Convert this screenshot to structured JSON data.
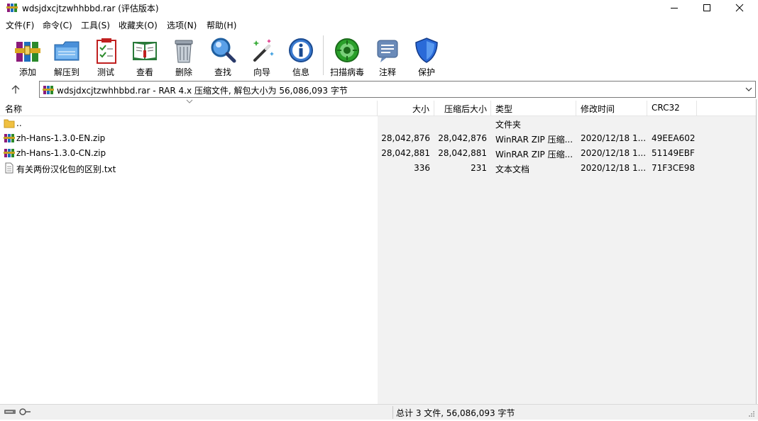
{
  "window": {
    "title": "wdsjdxcjtzwhhbbd.rar (评估版本)"
  },
  "menu": {
    "items": [
      "文件(F)",
      "命令(C)",
      "工具(S)",
      "收藏夹(O)",
      "选项(N)",
      "帮助(H)"
    ]
  },
  "toolbar": {
    "buttons": [
      {
        "label": "添加",
        "icon": "add-archive-icon"
      },
      {
        "label": "解压到",
        "icon": "extract-icon"
      },
      {
        "label": "测试",
        "icon": "test-icon"
      },
      {
        "label": "查看",
        "icon": "view-book-icon"
      },
      {
        "label": "删除",
        "icon": "trash-icon"
      },
      {
        "label": "查找",
        "icon": "magnifier-icon"
      },
      {
        "label": "向导",
        "icon": "wizard-wand-icon"
      },
      {
        "label": "信息",
        "icon": "info-icon"
      },
      {
        "label": "扫描病毒",
        "icon": "virus-scan-icon"
      },
      {
        "label": "注释",
        "icon": "comment-icon"
      },
      {
        "label": "保护",
        "icon": "shield-icon"
      }
    ]
  },
  "address": {
    "text": "wdsjdxcjtzwhhbbd.rar - RAR 4.x 压缩文件, 解包大小为 56,086,093 字节"
  },
  "columns": {
    "name": "名称",
    "size": "大小",
    "packed": "压缩后大小",
    "type": "类型",
    "modified": "修改时间",
    "crc": "CRC32"
  },
  "files": [
    {
      "name": "..",
      "size": "",
      "packed": "",
      "type": "文件夹",
      "modified": "",
      "crc": "",
      "icon": "folder-icon"
    },
    {
      "name": "zh-Hans-1.3.0-EN.zip",
      "size": "28,042,876",
      "packed": "28,042,876",
      "type": "WinRAR ZIP 压缩...",
      "modified": "2020/12/18 1...",
      "crc": "49EEA602",
      "icon": "zip-archive-icon"
    },
    {
      "name": "zh-Hans-1.3.0-CN.zip",
      "size": "28,042,881",
      "packed": "28,042,881",
      "type": "WinRAR ZIP 压缩...",
      "modified": "2020/12/18 1...",
      "crc": "51149EBF",
      "icon": "zip-archive-icon"
    },
    {
      "name": "有关两份汉化包的区别.txt",
      "size": "336",
      "packed": "231",
      "type": "文本文档",
      "modified": "2020/12/18 1...",
      "crc": "71F3CE98",
      "icon": "text-file-icon"
    }
  ],
  "status": {
    "text": "总计 3 文件, 56,086,093 字节"
  }
}
